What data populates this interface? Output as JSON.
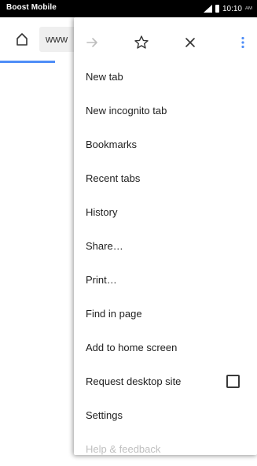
{
  "status_bar": {
    "carrier": "Boost Mobile",
    "time": "10:10",
    "time_suffix": "AM"
  },
  "toolbar": {
    "url_text": "www"
  },
  "menu": {
    "top_icons": [
      "forward-icon",
      "star-icon",
      "close-icon",
      "more-vert-icon"
    ],
    "items": [
      {
        "label": "New tab"
      },
      {
        "label": "New incognito tab"
      },
      {
        "label": "Bookmarks"
      },
      {
        "label": "Recent tabs"
      },
      {
        "label": "History"
      },
      {
        "label": "Share…"
      },
      {
        "label": "Print…"
      },
      {
        "label": "Find in page"
      },
      {
        "label": "Add to home screen"
      },
      {
        "label": "Request desktop site",
        "checkbox": false
      },
      {
        "label": "Settings"
      },
      {
        "label": "Help & feedback"
      }
    ]
  },
  "colors": {
    "accent_blue": "#4f8ef7",
    "status_bg": "#000000",
    "text": "#202020"
  }
}
